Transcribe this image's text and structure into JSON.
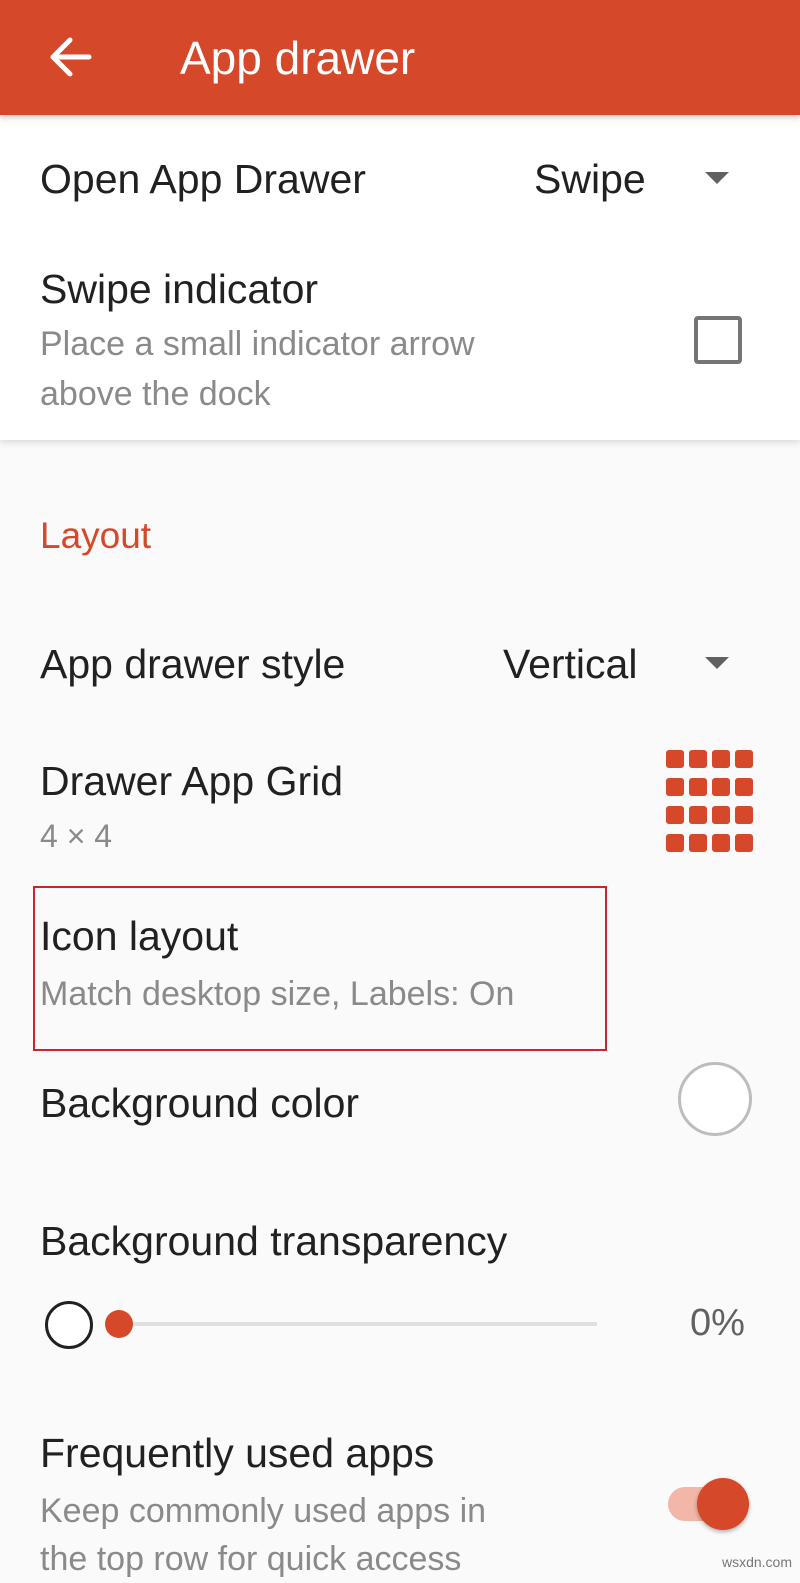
{
  "header": {
    "title": "App drawer"
  },
  "accent_color": "#d5482a",
  "settings": {
    "open_drawer": {
      "label": "Open App Drawer",
      "value": "Swipe"
    },
    "swipe_indicator": {
      "label": "Swipe indicator",
      "sub_line1": "Place a small indicator arrow",
      "sub_line2": "above the dock",
      "checked": false
    },
    "layout_section": "Layout",
    "drawer_style": {
      "label": "App drawer style",
      "value": "Vertical"
    },
    "drawer_grid": {
      "label": "Drawer App Grid",
      "value": "4 × 4",
      "icon": "grid-icon"
    },
    "icon_layout": {
      "label": "Icon layout",
      "summary": "Match desktop size, Labels: On"
    },
    "background_color": {
      "label": "Background color",
      "color": "#ffffff"
    },
    "background_transparency": {
      "label": "Background transparency",
      "value": "0%",
      "level": 0
    },
    "frequently_used": {
      "label": "Frequently used apps",
      "sub_line1": "Keep commonly used apps in",
      "sub_line2": "the top row for quick access",
      "enabled": true
    }
  },
  "watermark": "wsxdn.com"
}
